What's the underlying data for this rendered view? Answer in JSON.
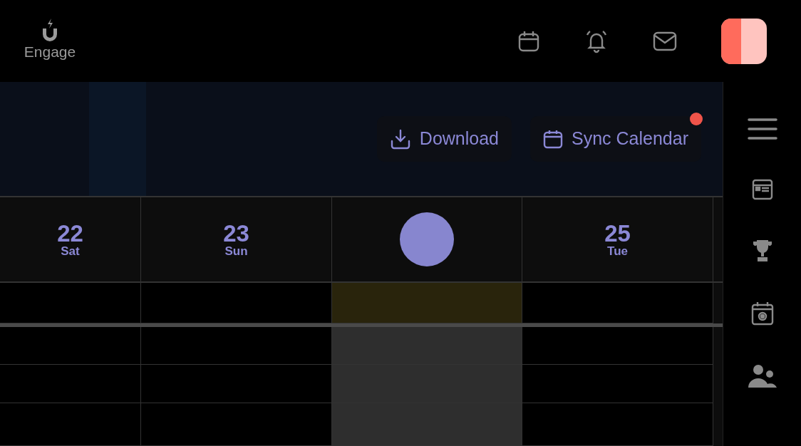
{
  "app": {
    "name": "Engage"
  },
  "actions": [
    {
      "kind": "download",
      "label": "Download",
      "notification": false
    },
    {
      "kind": "calendar",
      "label": "Sync Calendar",
      "notification": true
    }
  ],
  "days": [
    {
      "day": "22",
      "weekday": "Sat",
      "today": false
    },
    {
      "day": "23",
      "weekday": "Sun",
      "today": false
    },
    {
      "today": true
    },
    {
      "day": "25",
      "weekday": "Tue",
      "today": false
    }
  ]
}
